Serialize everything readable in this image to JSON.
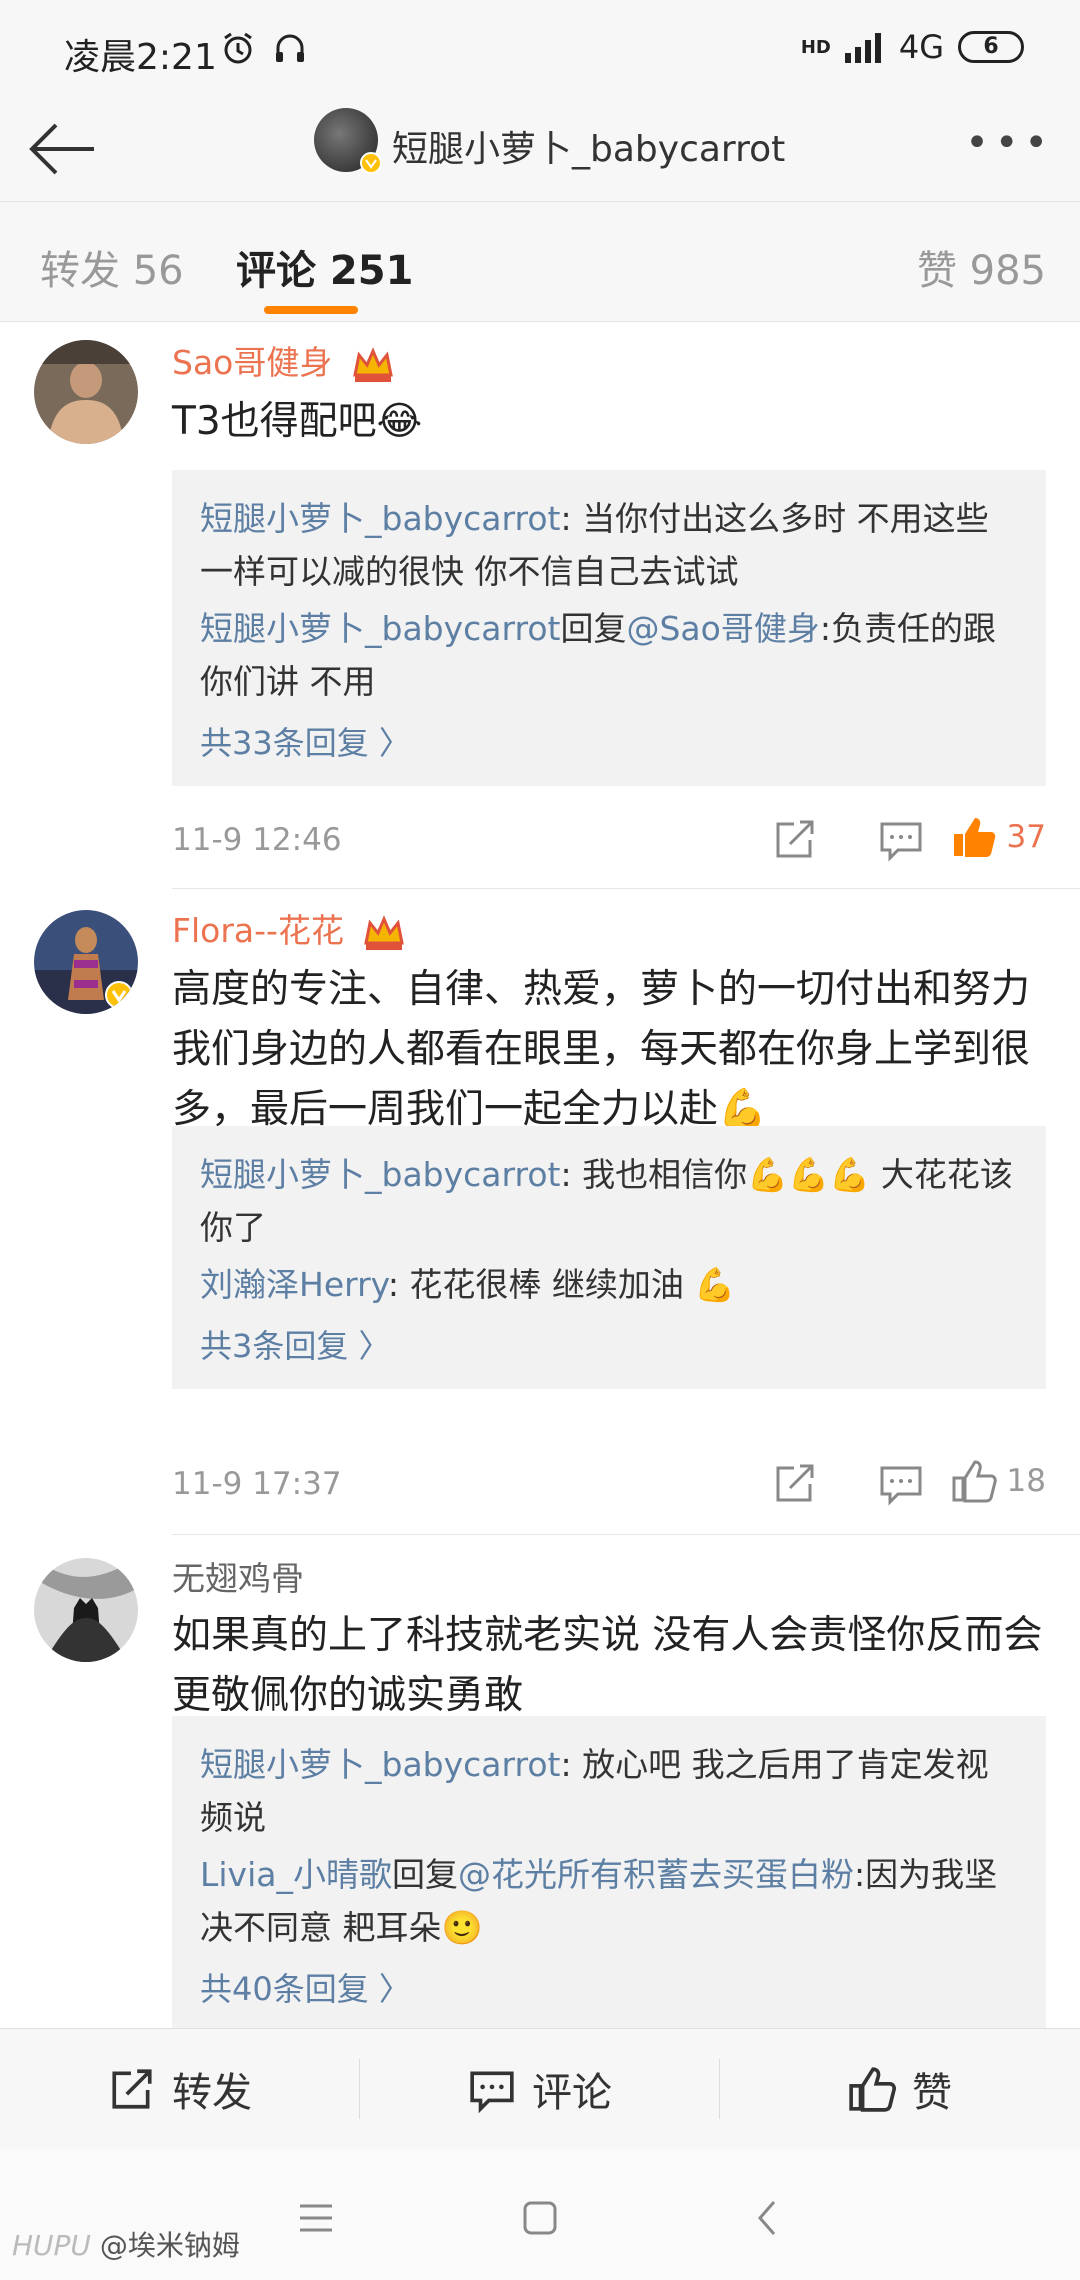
{
  "status_bar": {
    "time": "凌晨2:21",
    "network": "4G",
    "signal_label": "HD",
    "battery": "6"
  },
  "header": {
    "title": "短腿小萝卜_babycarrot"
  },
  "tabs": [
    {
      "label": "转发 56"
    },
    {
      "label": "评论 251"
    },
    {
      "label": "赞 985"
    }
  ],
  "comments": [
    {
      "username": "Sao哥健身",
      "text": "T3也得配吧😂",
      "replies": [
        {
          "name": "短腿小萝卜_babycarrot",
          "text": ": 当你付出这么多时 不用这些一样可以减的很快 你不信自己去试试"
        },
        {
          "name": "短腿小萝卜_babycarrot",
          "mid": "回复",
          "name2": "@Sao哥健身",
          "text": ":负责任的跟你们讲 不用"
        }
      ],
      "more": "共33条回复 〉",
      "time": "11-9 12:46",
      "likes": "37"
    },
    {
      "username": "Flora--花花",
      "text": "高度的专注、自律、热爱，萝卜的一切付出和努力我们身边的人都看在眼里，每天都在你身上学到很多，最后一周我们一起全力以赴💪",
      "replies": [
        {
          "name": "短腿小萝卜_babycarrot",
          "text": ": 我也相信你💪💪💪 大花花该你了"
        },
        {
          "name": "刘瀚泽Herry",
          "text": ": 花花很棒 继续加油 💪"
        }
      ],
      "more": "共3条回复 〉",
      "time": "11-9 17:37",
      "likes": "18"
    },
    {
      "username": "无翅鸡骨",
      "text": "如果真的上了科技就老实说 没有人会责怪你反而会更敬佩你的诚实勇敢",
      "replies": [
        {
          "name": "短腿小萝卜_babycarrot",
          "text": ": 放心吧 我之后用了肯定发视频说"
        },
        {
          "name": "Livia_小晴歌",
          "mid": "回复",
          "name2": "@花光所有积蓄去买蛋白粉",
          "text": ":因为我坚决不同意 耙耳朵🙂"
        }
      ],
      "more": "共40条回复 〉"
    }
  ],
  "actions": {
    "repost": "转发",
    "comment": "评论",
    "like": "赞"
  },
  "watermark": {
    "site": "HUPU",
    "user": "@埃米钠姆"
  },
  "colors": {
    "accent": "#ff8200",
    "username": "#eb7350",
    "link": "#5d7fa4"
  }
}
